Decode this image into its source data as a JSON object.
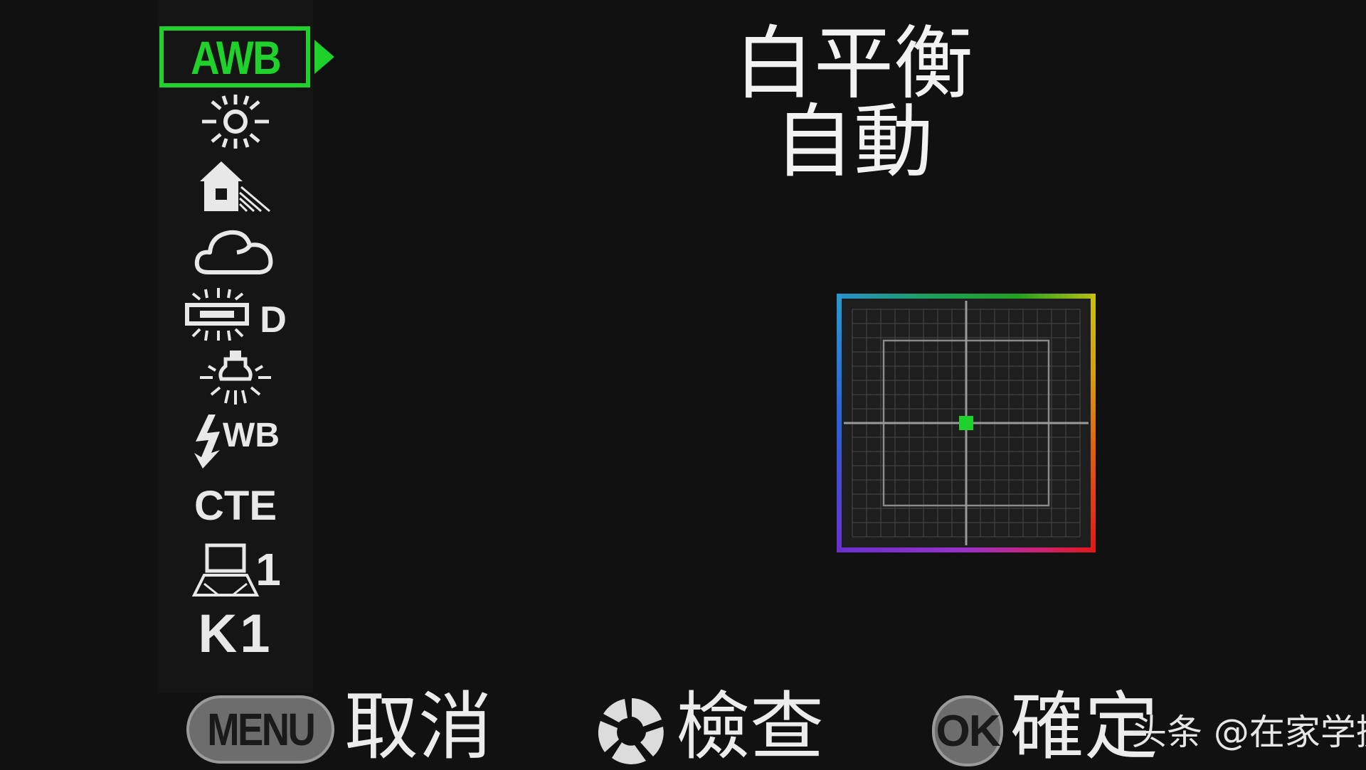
{
  "title": {
    "line1": "白平衡",
    "line2": "自動"
  },
  "wb_modes": [
    {
      "id": "awb",
      "label": "AWB",
      "icon": "awb-icon",
      "selected": true
    },
    {
      "id": "daylight",
      "label": "",
      "icon": "sun-icon",
      "selected": false
    },
    {
      "id": "shade",
      "label": "",
      "icon": "shade-house-icon",
      "selected": false
    },
    {
      "id": "cloudy",
      "label": "",
      "icon": "cloud-icon",
      "selected": false
    },
    {
      "id": "fluorescent",
      "label": "D",
      "icon": "fluorescent-icon",
      "selected": false
    },
    {
      "id": "tungsten",
      "label": "",
      "icon": "bulb-icon",
      "selected": false
    },
    {
      "id": "flash",
      "label": "WB",
      "icon": "flash-wb-icon",
      "selected": false
    },
    {
      "id": "cte",
      "label": "CTE",
      "icon": "cte-icon",
      "selected": false
    },
    {
      "id": "manual1",
      "label": "1",
      "icon": "manual-wb-icon",
      "selected": false
    },
    {
      "id": "kelvin1",
      "label": "K1",
      "icon": "kelvin-icon",
      "selected": false
    }
  ],
  "colors": {
    "accent": "#1fd22b",
    "text": "#e8e8e8",
    "background": "#111111"
  },
  "fine_tune": {
    "x": 0,
    "y": 0
  },
  "footer": {
    "menu_button": "MENU",
    "cancel_label": "取消",
    "check_icon": "aperture-icon",
    "check_label": "檢查",
    "ok_button": "OK",
    "confirm_label": "確定"
  },
  "watermark": "头条 @在家学摄影"
}
